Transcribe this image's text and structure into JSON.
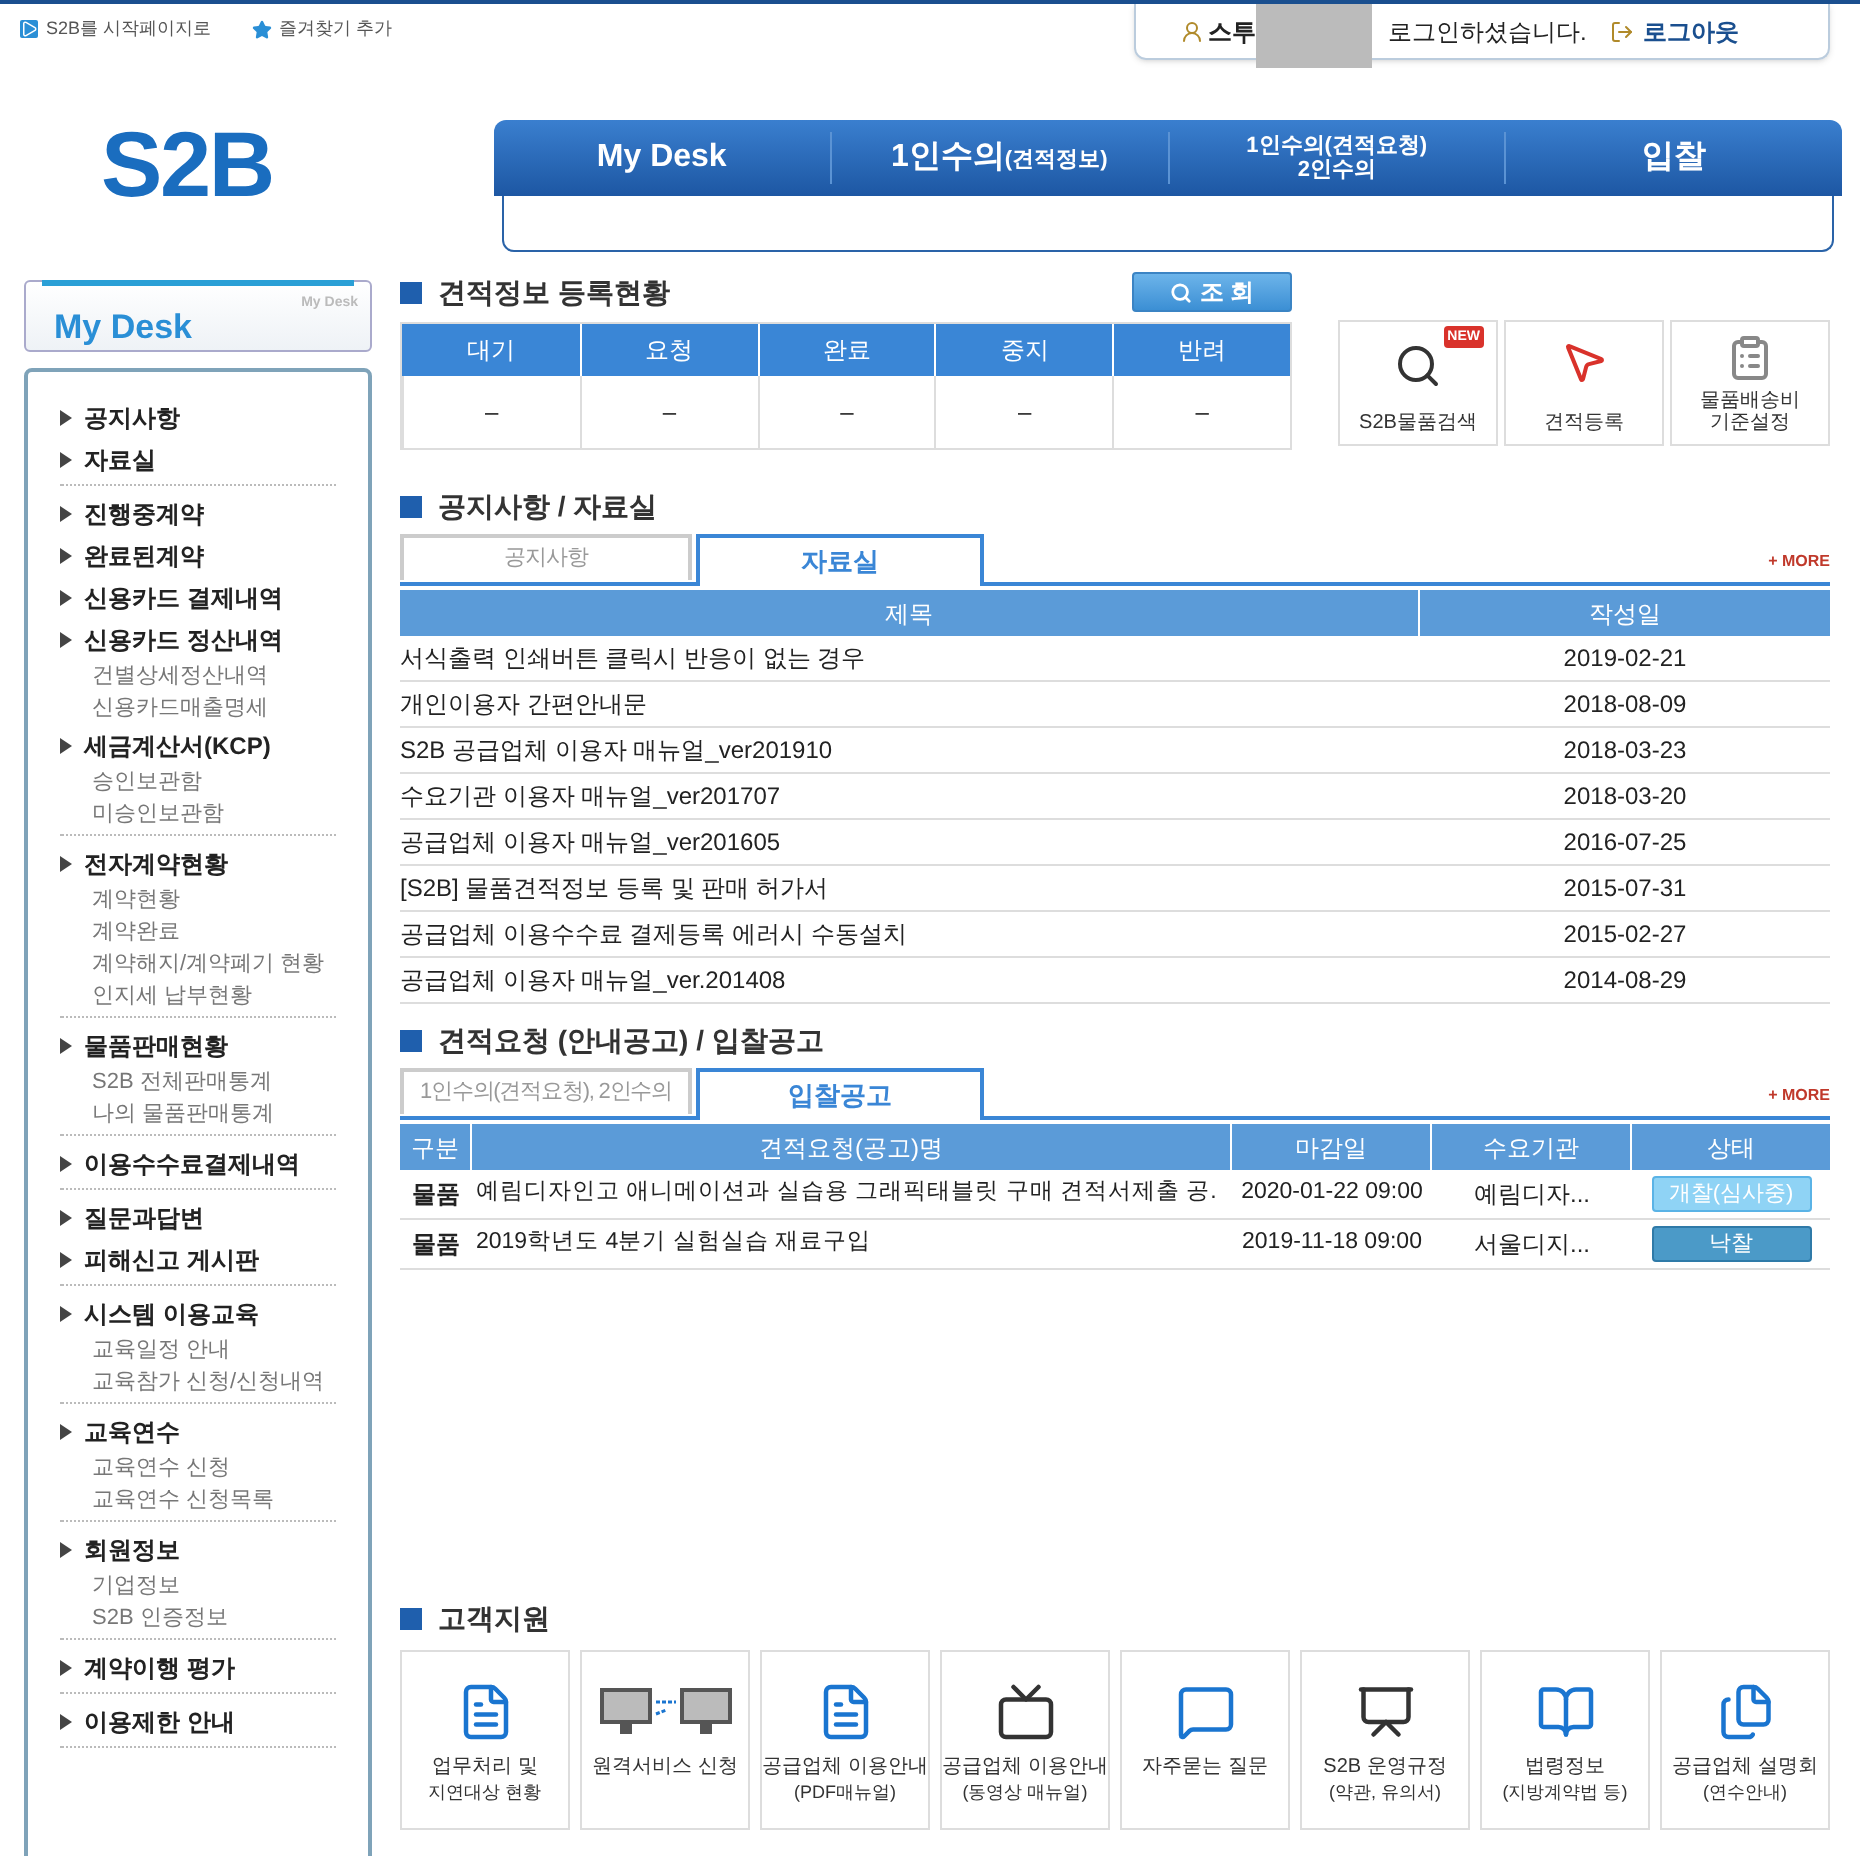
{
  "top_links": [
    {
      "label": "S2B를 시작페이지로"
    },
    {
      "label": "즐겨찾기 추가"
    }
  ],
  "login": {
    "user": "스투",
    "message": "로그인하셨습니다.",
    "logout": "로그아웃"
  },
  "logo": "S2B",
  "nav": [
    {
      "label": "My Desk"
    },
    {
      "label": "1인수의",
      "sub": "(견적정보)"
    },
    {
      "label": "1인수의(견적요청)",
      "line2": "2인수의"
    },
    {
      "label": "입찰"
    }
  ],
  "sidebar": {
    "title": "My Desk",
    "badge": "My Desk",
    "groups": [
      [
        {
          "label": "공지사항"
        },
        {
          "label": "자료실"
        }
      ],
      [
        {
          "label": "진행중계약"
        },
        {
          "label": "완료된계약"
        },
        {
          "label": "신용카드 결제내역"
        },
        {
          "label": "신용카드 정산내역",
          "children": [
            "건별상세정산내역",
            "신용카드매출명세"
          ]
        },
        {
          "label": "세금계산서(KCP)",
          "children": [
            "승인보관함",
            "미승인보관함"
          ]
        }
      ],
      [
        {
          "label": "전자계약현황",
          "children": [
            "계약현황",
            "계약완료",
            "계약해지/계약폐기 현황",
            "인지세 납부현황"
          ]
        }
      ],
      [
        {
          "label": "물품판매현황",
          "children": [
            "S2B 전체판매통계",
            "나의 물품판매통계"
          ]
        }
      ],
      [
        {
          "label": "이용수수료결제내역"
        }
      ],
      [
        {
          "label": "질문과답변"
        },
        {
          "label": "피해신고 게시판"
        }
      ],
      [
        {
          "label": "시스템 이용교육",
          "children": [
            "교육일정 안내",
            "교육참가 신청/신청내역"
          ]
        }
      ],
      [
        {
          "label": "교육연수",
          "children": [
            "교육연수 신청",
            "교육연수 신청목록"
          ]
        }
      ],
      [
        {
          "label": "회원정보",
          "children": [
            "기업정보",
            "S2B 인증정보"
          ]
        }
      ],
      [
        {
          "label": "계약이행 평가"
        }
      ],
      [
        {
          "label": "이용제한 안내"
        }
      ]
    ]
  },
  "quote_status": {
    "title": "견적정보 등록현황",
    "search_button": "조 회",
    "columns": [
      "대기",
      "요청",
      "완료",
      "중지",
      "반려"
    ],
    "values": [
      "–",
      "–",
      "–",
      "–",
      "–"
    ]
  },
  "quick_links": [
    {
      "label": "S2B물품검색",
      "badge": "NEW"
    },
    {
      "label": "견적등록"
    },
    {
      "label": "물품배송비 기준설정"
    }
  ],
  "notices": {
    "title": "공지사항 / 자료실",
    "more": "+ MORE",
    "tabs": [
      {
        "label": "공지사항",
        "selected": false
      },
      {
        "label": "자료실",
        "selected": true
      }
    ],
    "columns": [
      "제목",
      "작성일"
    ],
    "rows": [
      [
        "서식출력 인쇄버튼 클릭시 반응이 없는 경우",
        "2019-02-21"
      ],
      [
        "개인이용자 간편안내문",
        "2018-08-09"
      ],
      [
        "S2B 공급업체 이용자 매뉴얼_ver201910",
        "2018-03-23"
      ],
      [
        "수요기관 이용자 매뉴얼_ver201707",
        "2018-03-20"
      ],
      [
        "공급업체 이용자 매뉴얼_ver201605",
        "2016-07-25"
      ],
      [
        "[S2B] 물품견적정보 등록 및 판매 허가서",
        "2015-07-31"
      ],
      [
        "공급업체 이용수수료 결제등록 에러시 수동설치",
        "2015-02-27"
      ],
      [
        "공급업체 이용자 매뉴얼_ver.201408",
        "2014-08-29"
      ]
    ]
  },
  "bids": {
    "title": "견적요청 (안내공고) / 입찰공고",
    "more": "+ MORE",
    "tabs": [
      {
        "label": "1인수의(견적요청), 2인수의",
        "selected": false
      },
      {
        "label": "입찰공고",
        "selected": true
      }
    ],
    "columns": [
      "구분",
      "견적요청(공고)명",
      "마감일",
      "수요기관",
      "상태"
    ],
    "rows": [
      {
        "category": "물품",
        "title": "예림디자인고 애니메이션과 실습용 그래픽태블릿 구매 견적서제출 공.",
        "deadline": "2020-01-22 09:00",
        "agency": "예림디자...",
        "status": {
          "label": "개찰(심사중)",
          "kind": "open"
        }
      },
      {
        "category": "물품",
        "title": "2019학년도 4분기 실험실습 재료구입",
        "deadline": "2019-11-18 09:00",
        "agency": "서울디지...",
        "status": {
          "label": "낙찰",
          "kind": "awarded"
        }
      }
    ]
  },
  "support": {
    "title": "고객지원",
    "items": [
      {
        "label": "업무처리 및",
        "line2": "지연대상 현황"
      },
      {
        "label": "원격서비스 신청"
      },
      {
        "label": "공급업체 이용안내",
        "line2": "(PDF매뉴얼)"
      },
      {
        "label": "공급업체 이용안내",
        "line2": "(동영상 매뉴얼)"
      },
      {
        "label": "자주묻는 질문"
      },
      {
        "label": "S2B 운영규정",
        "line2": "(약관, 유의서)"
      },
      {
        "label": "법령정보",
        "line2": "(지방계약법 등)"
      },
      {
        "label": "공급업체 설명회",
        "line2": "(연수안내)"
      }
    ]
  }
}
